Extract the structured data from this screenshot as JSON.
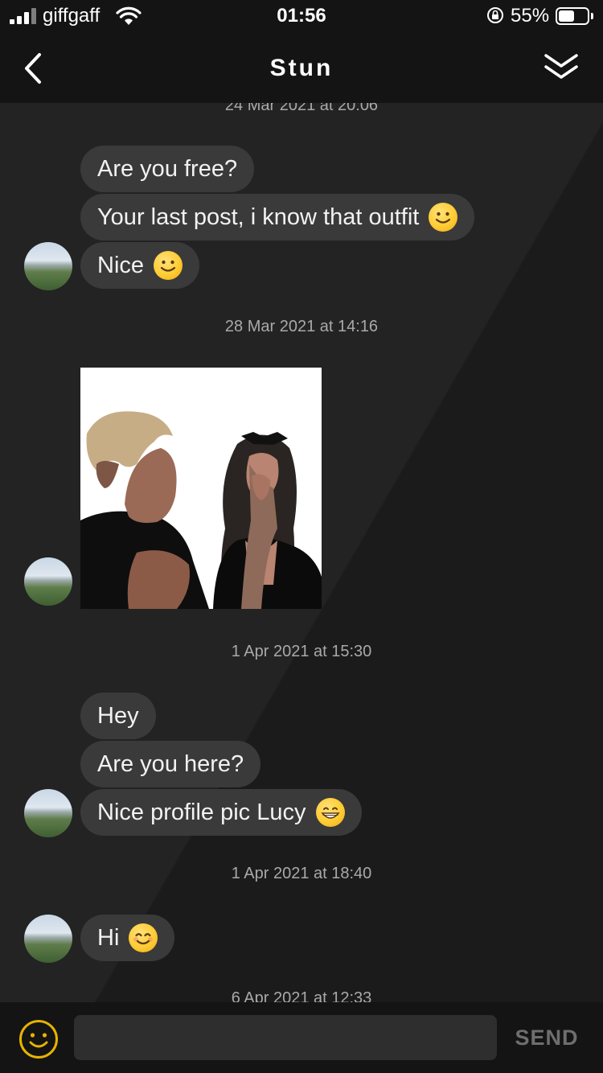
{
  "status_bar": {
    "carrier": "giffgaff",
    "time": "01:56",
    "battery_percent": "55%",
    "battery_level": 0.55
  },
  "header": {
    "title": "Stun",
    "back_icon": "chevron-left-icon",
    "collapse_icon": "double-chevron-down-icon"
  },
  "timestamps": {
    "t1": "24 Mar 2021 at 20:06",
    "t2": "28 Mar 2021 at 14:16",
    "t3": "1 Apr 2021 at 15:30",
    "t4": "1 Apr 2021 at 18:40",
    "t5": "6 Apr 2021 at 12:33"
  },
  "messages": {
    "m1": {
      "text": "Are you free?"
    },
    "m2": {
      "text": "Your last post, i know that outfit",
      "emoji": "slightly-smiling-face"
    },
    "m3": {
      "text": "Nice",
      "emoji": "slightly-smiling-face"
    },
    "m4": {
      "image": "avatar-couple-photo"
    },
    "m5": {
      "text": "Hey"
    },
    "m6": {
      "text": "Are you here?"
    },
    "m7": {
      "text": "Nice profile pic Lucy",
      "emoji": "grinning-face"
    },
    "m8": {
      "text": "Hi",
      "emoji": "smiling-face-with-smiling-eyes"
    }
  },
  "composer": {
    "input_value": "",
    "input_placeholder": "",
    "send_label": "SEND",
    "emoji_icon": "smiley-icon"
  },
  "colors": {
    "background": "#1c1c1c",
    "bars": "#141414",
    "bubble": "#3a3a3a",
    "timestamp_text": "#a9a9a9",
    "send_disabled": "#6e6e6e",
    "emoji_button": "#e6b400"
  }
}
